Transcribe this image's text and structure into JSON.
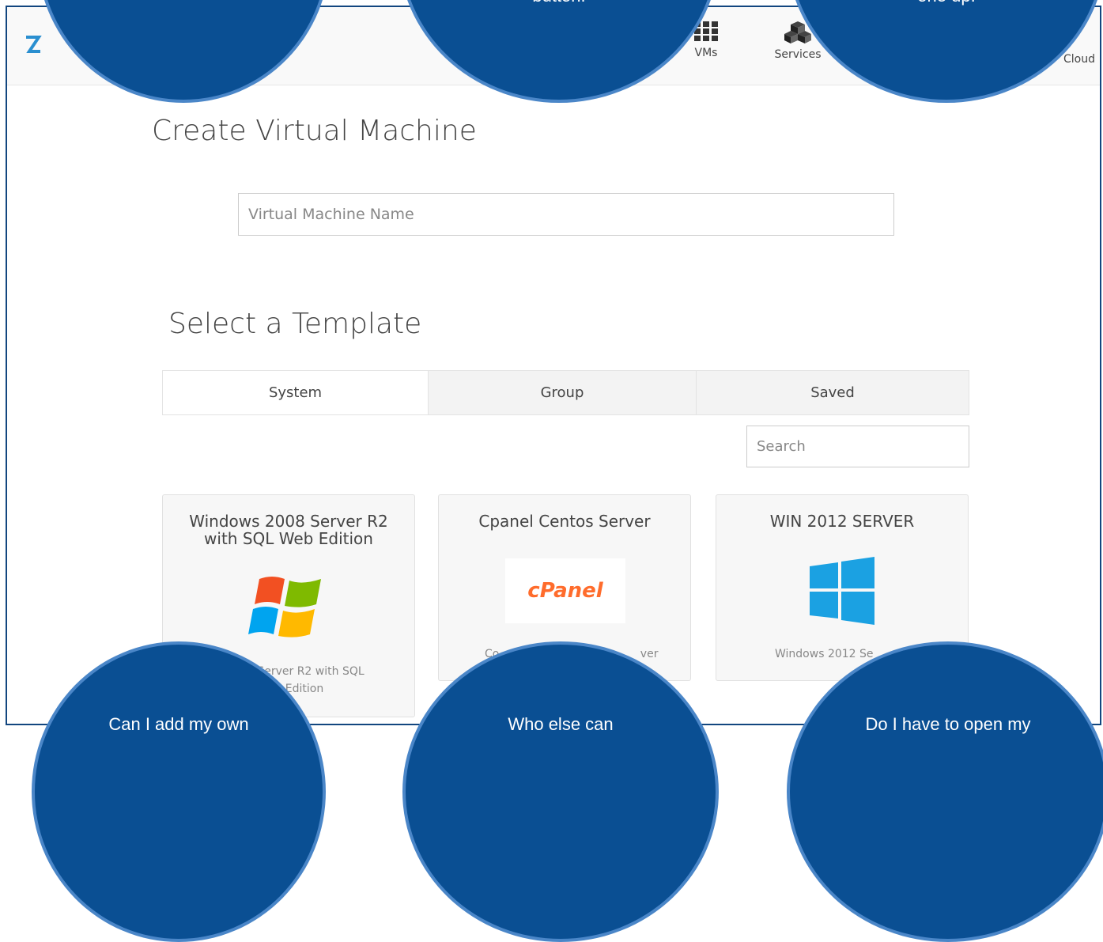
{
  "nav": {
    "items": [
      {
        "label": "VMs",
        "icon": "vms-grid-icon"
      },
      {
        "label": "Services",
        "icon": "services-cubes-icon"
      },
      {
        "label": "Cloud",
        "icon": "cloud-icon"
      }
    ]
  },
  "page": {
    "title": "Create Virtual Machine",
    "name_placeholder": "Virtual Machine Name",
    "template_heading": "Select a Template"
  },
  "tabs": [
    {
      "label": "System",
      "active": true
    },
    {
      "label": "Group",
      "active": false
    },
    {
      "label": "Saved",
      "active": false
    }
  ],
  "search": {
    "placeholder": "Search"
  },
  "templates": [
    {
      "title": "Windows 2008 Server R2 with SQL Web Edition",
      "desc_visible": "Server R2 with SQL",
      "desc_visible_2": "Edition",
      "logo": "windows-xp-logo"
    },
    {
      "title": "Cpanel Centos Server",
      "desc_visible": "Co",
      "desc_visible_2": "ver",
      "logo_text": "cPanel"
    },
    {
      "title": "WIN 2012 SERVER",
      "desc_visible": "Windows 2012 Se",
      "logo": "windows-8-logo"
    }
  ],
  "bubbles": {
    "top_left": "",
    "top_center": "button!",
    "top_right": "one up.",
    "bottom_left": "Can I add my own",
    "bottom_center": "Who else can",
    "bottom_right": "Do I have to open my"
  },
  "colors": {
    "bubble_fill": "#0a4f93",
    "bubble_border": "#4a86c8",
    "frame_border": "#12467f",
    "cpanel_orange": "#ff6c2c",
    "win8_blue": "#1ba1e2"
  }
}
